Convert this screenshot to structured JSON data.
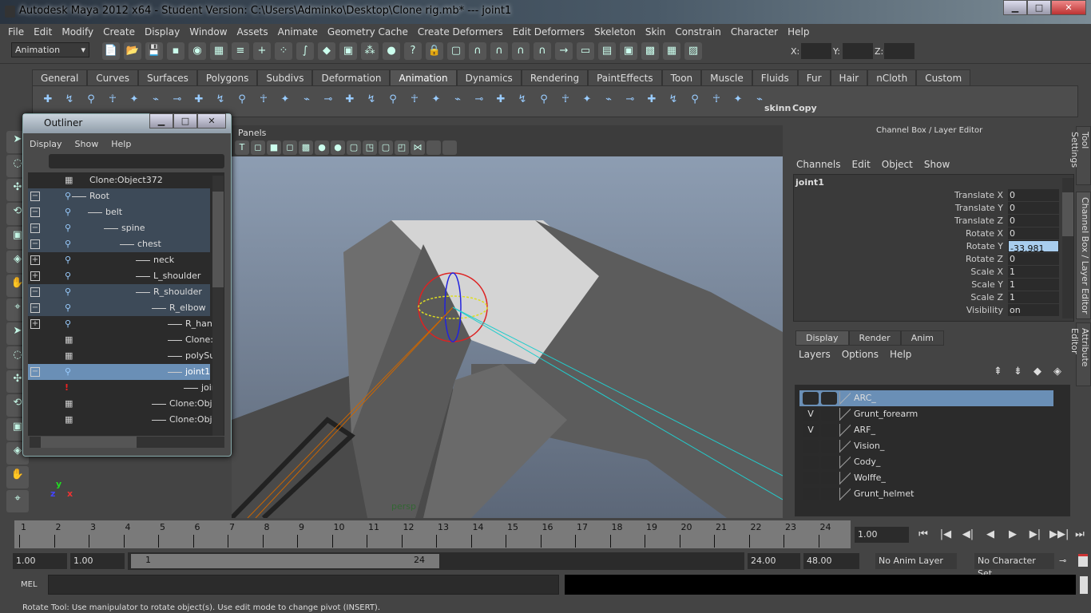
{
  "title": "Autodesk Maya 2012 x64 - Student Version: C:\\Users\\Adminko\\Desktop\\Clone rig.mb*   ---   joint1",
  "window_controls": {
    "minimize": "▁",
    "maximize": "□",
    "close": "✕"
  },
  "menu": [
    "File",
    "Edit",
    "Modify",
    "Create",
    "Display",
    "Window",
    "Assets",
    "Animate",
    "Geometry Cache",
    "Create Deformers",
    "Edit Deformers",
    "Skeleton",
    "Skin",
    "Constrain",
    "Character",
    "Help"
  ],
  "status_line": {
    "menu_set": "Animation",
    "x_label": "X:",
    "y_label": "Y:",
    "z_label": "Z:"
  },
  "shelf_tabs": [
    "General",
    "Curves",
    "Surfaces",
    "Polygons",
    "Subdivs",
    "Deformation",
    "Animation",
    "Dynamics",
    "Rendering",
    "PaintEffects",
    "Toon",
    "Muscle",
    "Fluids",
    "Fur",
    "Hair",
    "nCloth",
    "Custom"
  ],
  "shelf_active": "Animation",
  "shelf_labels": {
    "skinn": "skinn",
    "copy": "Copy"
  },
  "viewport": {
    "menu_panels": "Panels",
    "camera_label": "persp",
    "axis": {
      "y": "y",
      "z": "z",
      "x": "x"
    }
  },
  "outliner": {
    "title": "Outliner",
    "menu": [
      "Display",
      "Show",
      "Help"
    ],
    "rows": [
      {
        "label": "Clone:Object372",
        "icon": "mesh",
        "depth": 0,
        "expand": "",
        "style": ""
      },
      {
        "label": "Root",
        "icon": "joint",
        "depth": 0,
        "expand": "−",
        "style": "hl"
      },
      {
        "label": "belt",
        "icon": "joint",
        "depth": 1,
        "expand": "−",
        "style": "hl"
      },
      {
        "label": "spine",
        "icon": "joint",
        "depth": 2,
        "expand": "−",
        "style": "hl"
      },
      {
        "label": "chest",
        "icon": "joint",
        "depth": 3,
        "expand": "−",
        "style": "hl"
      },
      {
        "label": "neck",
        "icon": "joint",
        "depth": 4,
        "expand": "+",
        "style": ""
      },
      {
        "label": "L_shoulder",
        "icon": "joint",
        "depth": 4,
        "expand": "+",
        "style": ""
      },
      {
        "label": "R_shoulder",
        "icon": "joint",
        "depth": 4,
        "expand": "−",
        "style": "hl"
      },
      {
        "label": "R_elbow",
        "icon": "joint",
        "depth": 5,
        "expand": "−",
        "style": "hl"
      },
      {
        "label": "R_hand",
        "icon": "joint",
        "depth": 6,
        "expand": "+",
        "style": ""
      },
      {
        "label": "Clone:O",
        "icon": "mesh",
        "depth": 6,
        "expand": "",
        "style": ""
      },
      {
        "label": "polySur",
        "icon": "mesh",
        "depth": 6,
        "expand": "",
        "style": ""
      },
      {
        "label": "joint1",
        "icon": "joint",
        "depth": 6,
        "expand": "−",
        "style": "sel2"
      },
      {
        "label": "join",
        "icon": "warning",
        "depth": 7,
        "expand": "",
        "style": ""
      },
      {
        "label": "Clone:Objec",
        "icon": "mesh",
        "depth": 5,
        "expand": "",
        "style": ""
      },
      {
        "label": "Clone:Objec",
        "icon": "mesh",
        "depth": 5,
        "expand": "",
        "style": ""
      }
    ]
  },
  "channel_box": {
    "title": "Channel Box / Layer Editor",
    "menu": [
      "Channels",
      "Edit",
      "Object",
      "Show"
    ],
    "object": "joint1",
    "channels": [
      {
        "name": "Translate X",
        "value": "0"
      },
      {
        "name": "Translate Y",
        "value": "0"
      },
      {
        "name": "Translate Z",
        "value": "0"
      },
      {
        "name": "Rotate X",
        "value": "0"
      },
      {
        "name": "Rotate Y",
        "value": "-33.981",
        "selected": true
      },
      {
        "name": "Rotate Z",
        "value": "0"
      },
      {
        "name": "Scale X",
        "value": "1"
      },
      {
        "name": "Scale Y",
        "value": "1"
      },
      {
        "name": "Scale Z",
        "value": "1"
      },
      {
        "name": "Visibility",
        "value": "on"
      }
    ]
  },
  "layer_editor": {
    "tabs": [
      "Display",
      "Render",
      "Anim"
    ],
    "active_tab": "Display",
    "menu": [
      "Layers",
      "Options",
      "Help"
    ],
    "layers": [
      {
        "name": "ARC_",
        "v": "",
        "selected": true
      },
      {
        "name": "Grunt_forearm",
        "v": "V"
      },
      {
        "name": "ARF_",
        "v": "V"
      },
      {
        "name": "Vision_",
        "v": ""
      },
      {
        "name": "Cody_",
        "v": ""
      },
      {
        "name": "Wolffe_",
        "v": ""
      },
      {
        "name": "Grunt_helmet",
        "v": ""
      }
    ]
  },
  "side_tabs": [
    "Tool Settings",
    "Channel Box / Layer Editor",
    "Attribute Editor"
  ],
  "timeline": {
    "ticks": [
      "1",
      "2",
      "3",
      "4",
      "5",
      "6",
      "7",
      "8",
      "9",
      "10",
      "11",
      "12",
      "13",
      "14",
      "15",
      "16",
      "17",
      "18",
      "19",
      "20",
      "21",
      "22",
      "23",
      "24"
    ],
    "current_time": "1.00"
  },
  "playback": [
    "⏮",
    "|◀",
    "◀|",
    "◀",
    "▶",
    "▶|",
    "▶▶|",
    "⏭"
  ],
  "range": {
    "start": "1.00",
    "playback_start": "1.00",
    "slider_start": "1",
    "slider_end": "24",
    "playback_end": "24.00",
    "end": "48.00",
    "anim_layer": "No Anim Layer",
    "character_set": "No Character Set"
  },
  "command_line": {
    "label": "MEL",
    "value": ""
  },
  "help_line": "Rotate Tool: Use manipulator to rotate object(s). Use edit mode to change pivot (INSERT)."
}
